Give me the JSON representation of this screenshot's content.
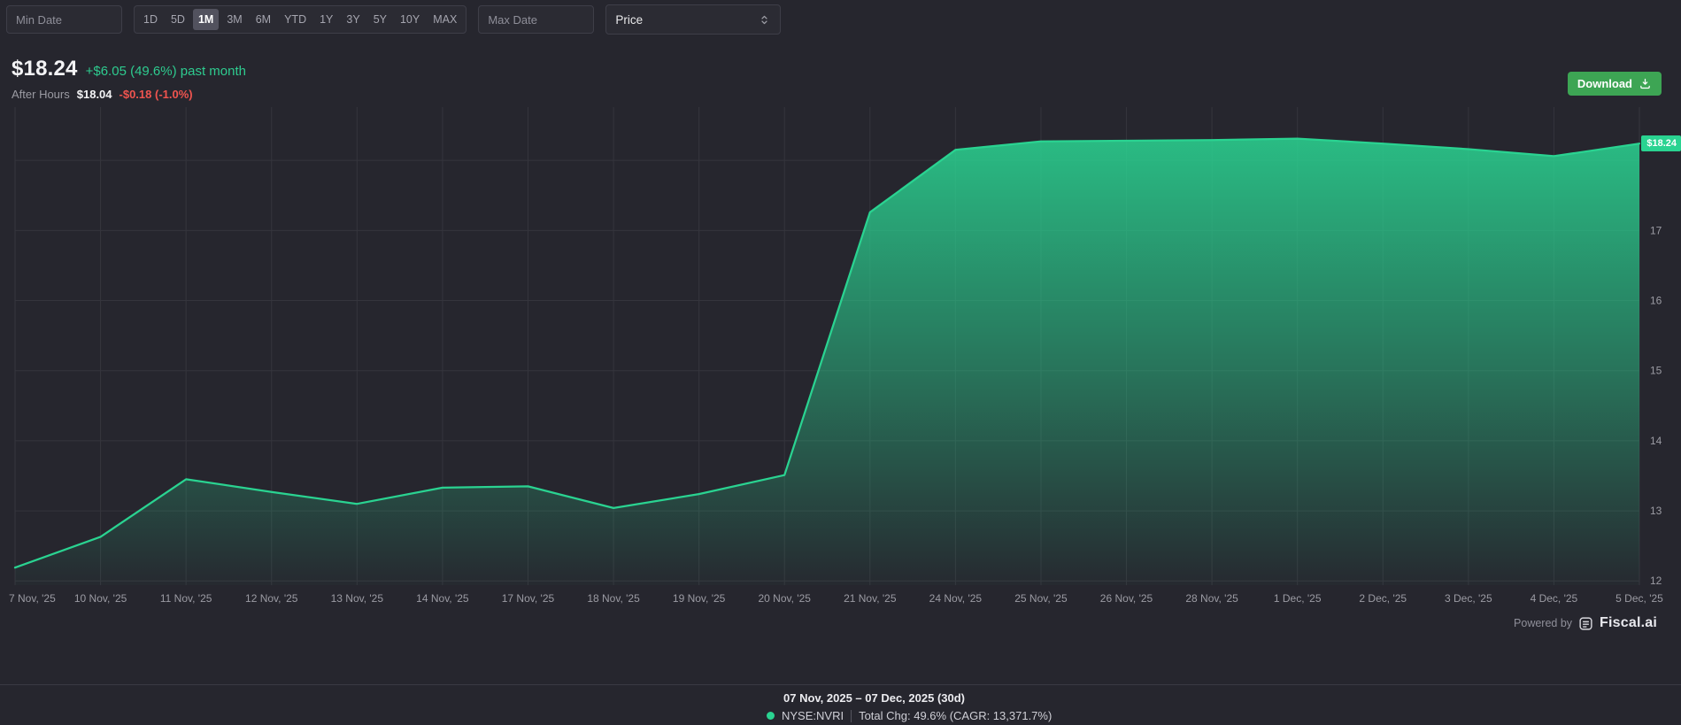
{
  "colors": {
    "panel-bg": "#26262e",
    "grid": "#35353d",
    "accent-green": "#2ad391",
    "positive": "#2ecb8f",
    "negative": "#f0544f",
    "download-green": "#3da554"
  },
  "toolbar": {
    "min_date_placeholder": "Min Date",
    "max_date_placeholder": "Max Date",
    "ranges": [
      "1D",
      "5D",
      "1M",
      "3M",
      "6M",
      "YTD",
      "1Y",
      "3Y",
      "5Y",
      "10Y",
      "MAX"
    ],
    "selected_range": "1M",
    "metric_selected": "Price"
  },
  "header": {
    "price": "$18.24",
    "change": "+$6.05 (49.6%) past month",
    "after_hours_label": "After Hours",
    "after_hours_price": "$18.04",
    "after_hours_change": "-$0.18 (-1.0%)",
    "download_label": "Download"
  },
  "chart_data": {
    "type": "area",
    "x": [
      "7 Nov, '25",
      "10 Nov, '25",
      "11 Nov, '25",
      "12 Nov, '25",
      "13 Nov, '25",
      "14 Nov, '25",
      "17 Nov, '25",
      "18 Nov, '25",
      "19 Nov, '25",
      "20 Nov, '25",
      "21 Nov, '25",
      "24 Nov, '25",
      "25 Nov, '25",
      "26 Nov, '25",
      "28 Nov, '25",
      "1 Dec, '25",
      "2 Dec, '25",
      "3 Dec, '25",
      "4 Dec, '25",
      "5 Dec, '25"
    ],
    "values": [
      12.19,
      12.63,
      13.45,
      13.27,
      13.1,
      13.33,
      13.35,
      13.04,
      13.24,
      13.51,
      17.26,
      18.15,
      18.27,
      18.28,
      18.29,
      18.31,
      18.24,
      18.16,
      18.06,
      18.24
    ],
    "ylim": [
      11.94,
      18.76
    ],
    "y_ticks": [
      17,
      16,
      15,
      14,
      13,
      12
    ],
    "y_grid": [
      18,
      17,
      16,
      15,
      14,
      13,
      12
    ],
    "grid": true,
    "legend_position": "none",
    "line_color": "#2ad391",
    "current_price_label": "$18.24",
    "last_value": 18.24
  },
  "footer": {
    "powered_by": "Powered by",
    "brand": "Fiscal.ai",
    "range_summary": "07 Nov, 2025 – 07 Dec, 2025 (30d)",
    "ticker": "NYSE:NVRI",
    "total_change": "Total Chg: 49.6% (CAGR: 13,371.7%)"
  }
}
